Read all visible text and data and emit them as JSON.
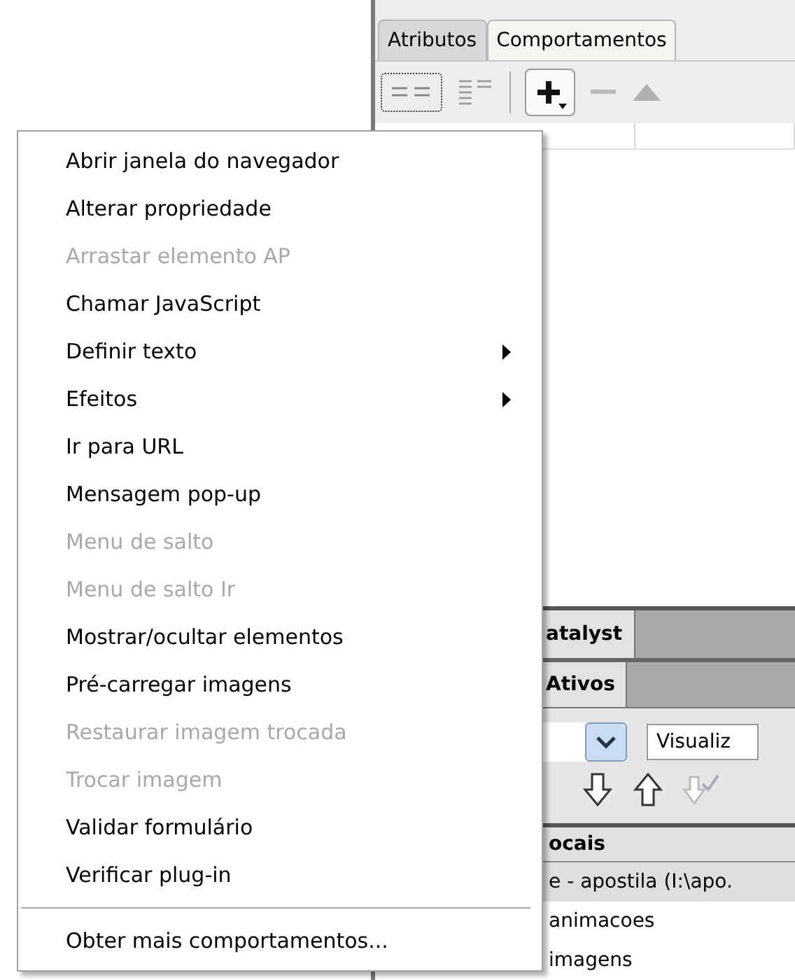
{
  "panel": {
    "tabs": [
      {
        "label": "Atributos",
        "selected": false
      },
      {
        "label": "Comportamentos",
        "selected": true
      }
    ]
  },
  "lower_panel": {
    "tabs": [
      {
        "label": "atalyst",
        "selected": true
      }
    ],
    "subtabs": [
      {
        "label": "Ativos",
        "selected": true
      }
    ],
    "view_field": {
      "value": "Visualiz"
    },
    "files_header": "ocais",
    "files": [
      {
        "name": "e - apostila (I:\\apo.",
        "selected": true
      },
      {
        "name": "animacoes",
        "selected": false
      },
      {
        "name": "imagens",
        "selected": false
      }
    ]
  },
  "menu": {
    "items": [
      {
        "label": "Abrir janela do navegador",
        "disabled": false,
        "submenu": false
      },
      {
        "label": "Alterar propriedade",
        "disabled": false,
        "submenu": false
      },
      {
        "label": "Arrastar elemento AP",
        "disabled": true,
        "submenu": false
      },
      {
        "label": "Chamar JavaScript",
        "disabled": false,
        "submenu": false
      },
      {
        "label": "Definir texto",
        "disabled": false,
        "submenu": true
      },
      {
        "label": "Efeitos",
        "disabled": false,
        "submenu": true
      },
      {
        "label": "Ir para URL",
        "disabled": false,
        "submenu": false
      },
      {
        "label": "Mensagem pop-up",
        "disabled": false,
        "submenu": false
      },
      {
        "label": "Menu de salto",
        "disabled": true,
        "submenu": false
      },
      {
        "label": "Menu de salto Ir",
        "disabled": true,
        "submenu": false
      },
      {
        "label": "Mostrar/ocultar elementos",
        "disabled": false,
        "submenu": false
      },
      {
        "label": "Pré-carregar imagens",
        "disabled": false,
        "submenu": false
      },
      {
        "label": "Restaurar imagem trocada",
        "disabled": true,
        "submenu": false
      },
      {
        "label": "Trocar imagem",
        "disabled": true,
        "submenu": false
      },
      {
        "label": "Validar formulário",
        "disabled": false,
        "submenu": false
      },
      {
        "label": "Verificar plug-in",
        "disabled": false,
        "submenu": false
      }
    ],
    "footer_item": {
      "label": "Obter mais comportamentos...",
      "disabled": false
    }
  }
}
